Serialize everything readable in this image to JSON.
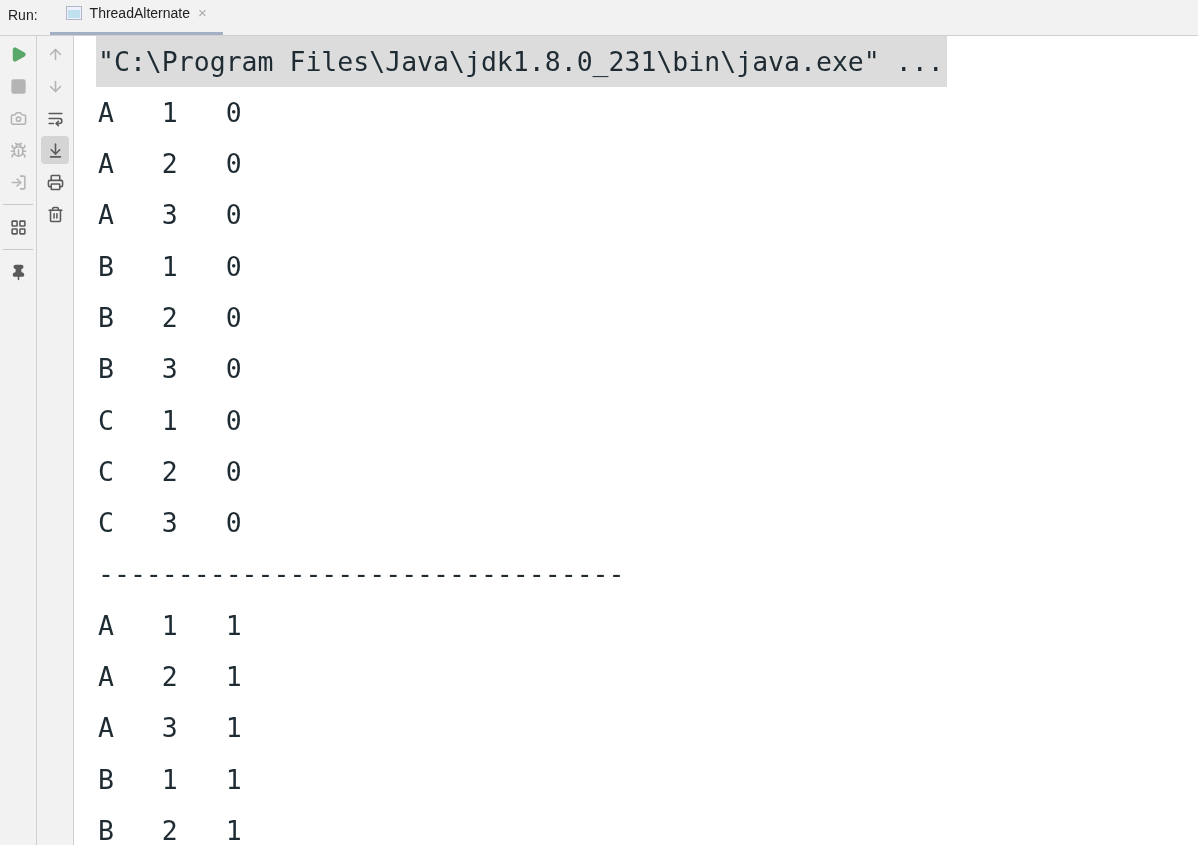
{
  "run_bar": {
    "label": "Run:",
    "tabs": [
      {
        "title": "ThreadAlternate",
        "selected": true,
        "close": "×"
      }
    ]
  },
  "left_toolbar": [
    {
      "kind": "run",
      "disabled": false
    },
    {
      "kind": "stop",
      "disabled": true
    },
    {
      "kind": "camera",
      "disabled": true
    },
    {
      "kind": "bug",
      "disabled": true
    },
    {
      "kind": "enter",
      "disabled": true
    },
    {
      "kind": "separator"
    },
    {
      "kind": "layout",
      "disabled": false
    },
    {
      "kind": "separator"
    },
    {
      "kind": "pin",
      "disabled": false
    }
  ],
  "right_toolbar": [
    {
      "kind": "up",
      "disabled": true,
      "selected": false
    },
    {
      "kind": "down",
      "disabled": true,
      "selected": false
    },
    {
      "kind": "wrap",
      "disabled": false,
      "selected": false
    },
    {
      "kind": "scroll-end",
      "disabled": false,
      "selected": true
    },
    {
      "kind": "print",
      "disabled": false,
      "selected": false
    },
    {
      "kind": "trash",
      "disabled": false,
      "selected": false
    }
  ],
  "console": {
    "command": "\"C:\\Program Files\\Java\\jdk1.8.0_231\\bin\\java.exe\" ...",
    "lines": [
      "A   1   0",
      "A   2   0",
      "A   3   0",
      "B   1   0",
      "B   2   0",
      "B   3   0",
      "C   1   0",
      "C   2   0",
      "C   3   0",
      "---------------------------------",
      "A   1   1",
      "A   2   1",
      "A   3   1",
      "B   1   1",
      "B   2   1"
    ]
  }
}
